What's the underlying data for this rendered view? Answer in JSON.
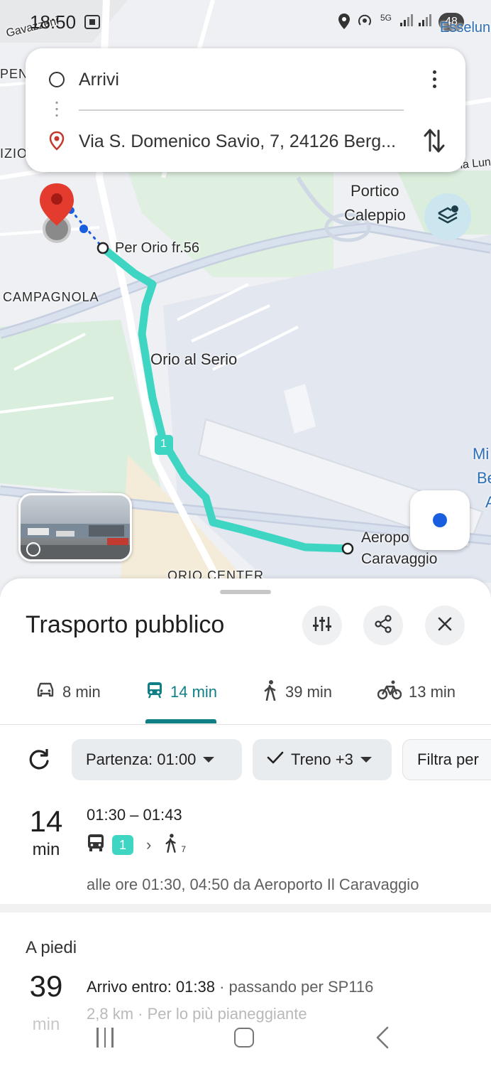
{
  "status_bar": {
    "time": "18:50",
    "battery": "48",
    "signal": "5G"
  },
  "map": {
    "labels": {
      "gavazzeni": "Gavazzeni",
      "pen": "PEN",
      "izio": "IZIO",
      "via_lung": "Via Lung",
      "portico": "Portico",
      "caleppio": "Caleppio",
      "stop_start": "Per Orio fr.56",
      "campagnola": "CAMPAGNOLA",
      "orio_al_serio": "Orio al Serio",
      "mi": "Mi",
      "berg": "Berg",
      "airp": "Airp",
      "aeroporto": "Aeropo",
      "caravaggio": "Caravaggio",
      "orio_center": "ORIO CENTER",
      "esselunga": "Esselun",
      "route_badge": "1"
    },
    "colors": {
      "route": "#3ed6c3",
      "pin": "#e33b2e",
      "location": "#1a5ee0"
    }
  },
  "search": {
    "origin": "Arrivi",
    "destination": "Via S. Domenico Savio, 7, 24126 Berg..."
  },
  "sheet": {
    "title": "Trasporto pubblico",
    "modes": [
      {
        "icon": "car-icon",
        "label": "8 min"
      },
      {
        "icon": "transit-icon",
        "label": "14 min",
        "active": true
      },
      {
        "icon": "walk-icon",
        "label": "39 min"
      },
      {
        "icon": "bike-icon",
        "label": "13 min"
      }
    ],
    "filters": {
      "departure": "Partenza: 01:00",
      "modes": "Treno +3",
      "filter": "Filtra per"
    },
    "route": {
      "duration_value": "14",
      "duration_unit": "min",
      "time_range": "01:30 – 01:43",
      "line": "1",
      "walk_minutes": "7",
      "description": "alle ore 01:30, 04:50 da Aeroporto Il Caravaggio"
    },
    "walking": {
      "title": "A piedi",
      "duration_value": "39",
      "duration_unit": "min",
      "arrival": "Arrivo entro: 01:38",
      "via": " · passando per SP116",
      "distance": "2,8 km",
      "terrain": " · Per lo più pianeggiante"
    }
  }
}
